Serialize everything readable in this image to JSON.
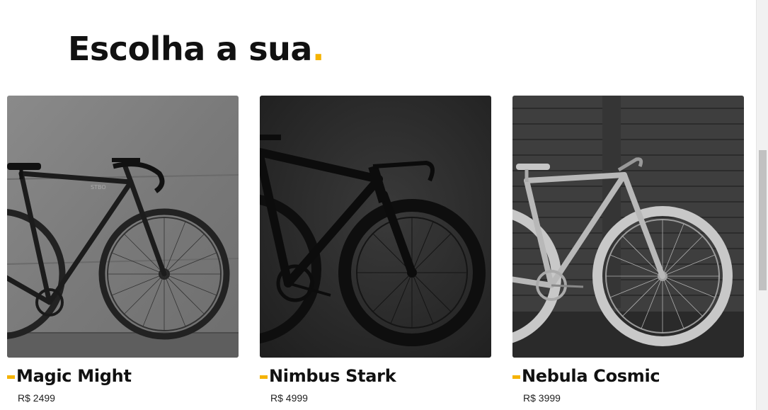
{
  "section": {
    "title": "Escolha a sua",
    "title_dot": ".",
    "accent_color": "#f5b301"
  },
  "products": [
    {
      "name": "Magic Might",
      "price": "R$ 2499",
      "image": "black-fixie-bicycle-against-concrete-wall"
    },
    {
      "name": "Nimbus Stark",
      "price": "R$ 4999",
      "image": "black-road-bicycle-on-dark-background"
    },
    {
      "name": "Nebula Cosmic",
      "price": "R$ 3999",
      "image": "grey-single-speed-bicycle-against-wooden-wall"
    }
  ]
}
